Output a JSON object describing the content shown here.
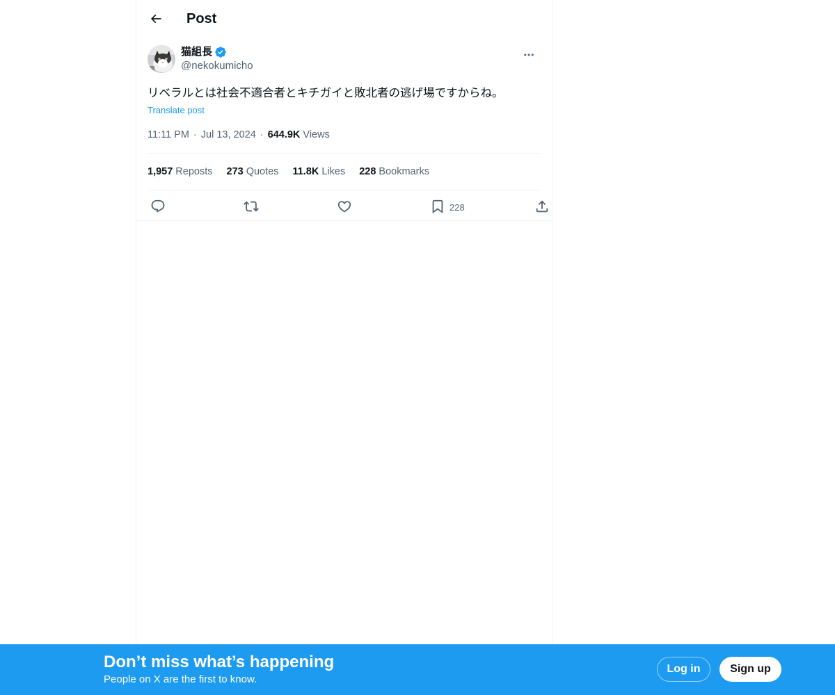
{
  "header": {
    "title": "Post",
    "back_icon": "arrow-left-icon"
  },
  "tweet": {
    "author": {
      "display_name": "猫組長",
      "handle": "@nekokumicho",
      "verified": true,
      "verified_color": "#1d9bf0"
    },
    "text": "リベラルとは社会不適合者とキチガイと敗北者の逃げ場ですからね。",
    "translate_label": "Translate post",
    "time": "11:11 PM",
    "date": "Jul 13, 2024",
    "views_count": "644.9K",
    "views_label": "Views",
    "stats": {
      "reposts_count": "1,957",
      "reposts_label": "Reposts",
      "quotes_count": "273",
      "quotes_label": "Quotes",
      "likes_count": "11.8K",
      "likes_label": "Likes",
      "bookmarks_count": "228",
      "bookmarks_label": "Bookmarks"
    },
    "actions": {
      "reply_icon": "reply-icon",
      "repost_icon": "repost-icon",
      "like_icon": "heart-icon",
      "bookmark_icon": "bookmark-icon",
      "bookmark_count": "228",
      "share_icon": "share-icon"
    }
  },
  "banner": {
    "title": "Don’t miss what’s happening",
    "subtitle": "People on X are the first to know.",
    "login_label": "Log in",
    "signup_label": "Sign up",
    "background": "#1d9bf0"
  },
  "colors": {
    "text_primary": "#0f1419",
    "text_secondary": "#536471",
    "link": "#1d9bf0",
    "border": "#eff3f4"
  }
}
